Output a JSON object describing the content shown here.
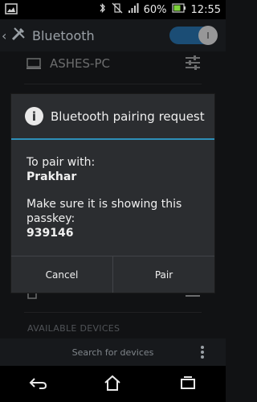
{
  "status_bar": {
    "battery_percent": "60%",
    "time": "12:55"
  },
  "action_bar": {
    "title": "Bluetooth"
  },
  "paired_devices": [
    {
      "name": "ASHES-PC"
    }
  ],
  "available_devices_header": "AVAILABLE DEVICES",
  "bottom_actions": {
    "search_label": "Search for devices"
  },
  "dialog": {
    "title": "Bluetooth pairing request",
    "line1": "To pair with:",
    "device_name": "Prakhar",
    "line2": "Make sure it is showing this passkey:",
    "passkey": "939146",
    "cancel_label": "Cancel",
    "pair_label": "Pair"
  },
  "colors": {
    "accent": "#2e8fb8",
    "toggle": "#1f6aa6"
  }
}
